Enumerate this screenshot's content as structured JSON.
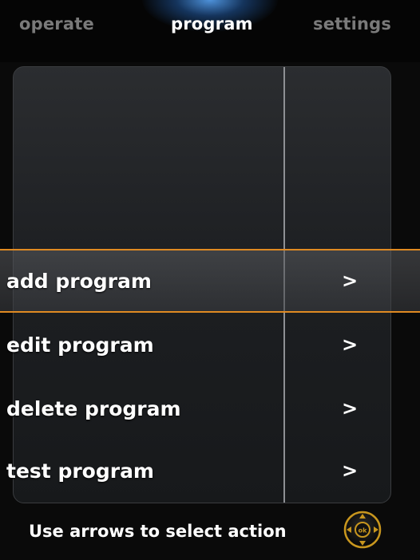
{
  "tabs": {
    "operate": "operate",
    "program": "program",
    "settings": "settings"
  },
  "menu": {
    "items": [
      {
        "label": "add program",
        "arrow": ">"
      },
      {
        "label": "edit program",
        "arrow": ">"
      },
      {
        "label": "delete program",
        "arrow": ">"
      },
      {
        "label": "test program",
        "arrow": ">"
      }
    ],
    "selected_index": 0
  },
  "hint": {
    "text": "Use arrows to select action"
  },
  "dpad": {
    "center_label": "ok",
    "icon": "dpad-ok-icon"
  },
  "colors": {
    "selection_accent": "#e08a22",
    "active_tab_glow": "#5aaaff",
    "inactive_tab": "#7a7a7a",
    "dpad_gold": "#c8961e"
  }
}
